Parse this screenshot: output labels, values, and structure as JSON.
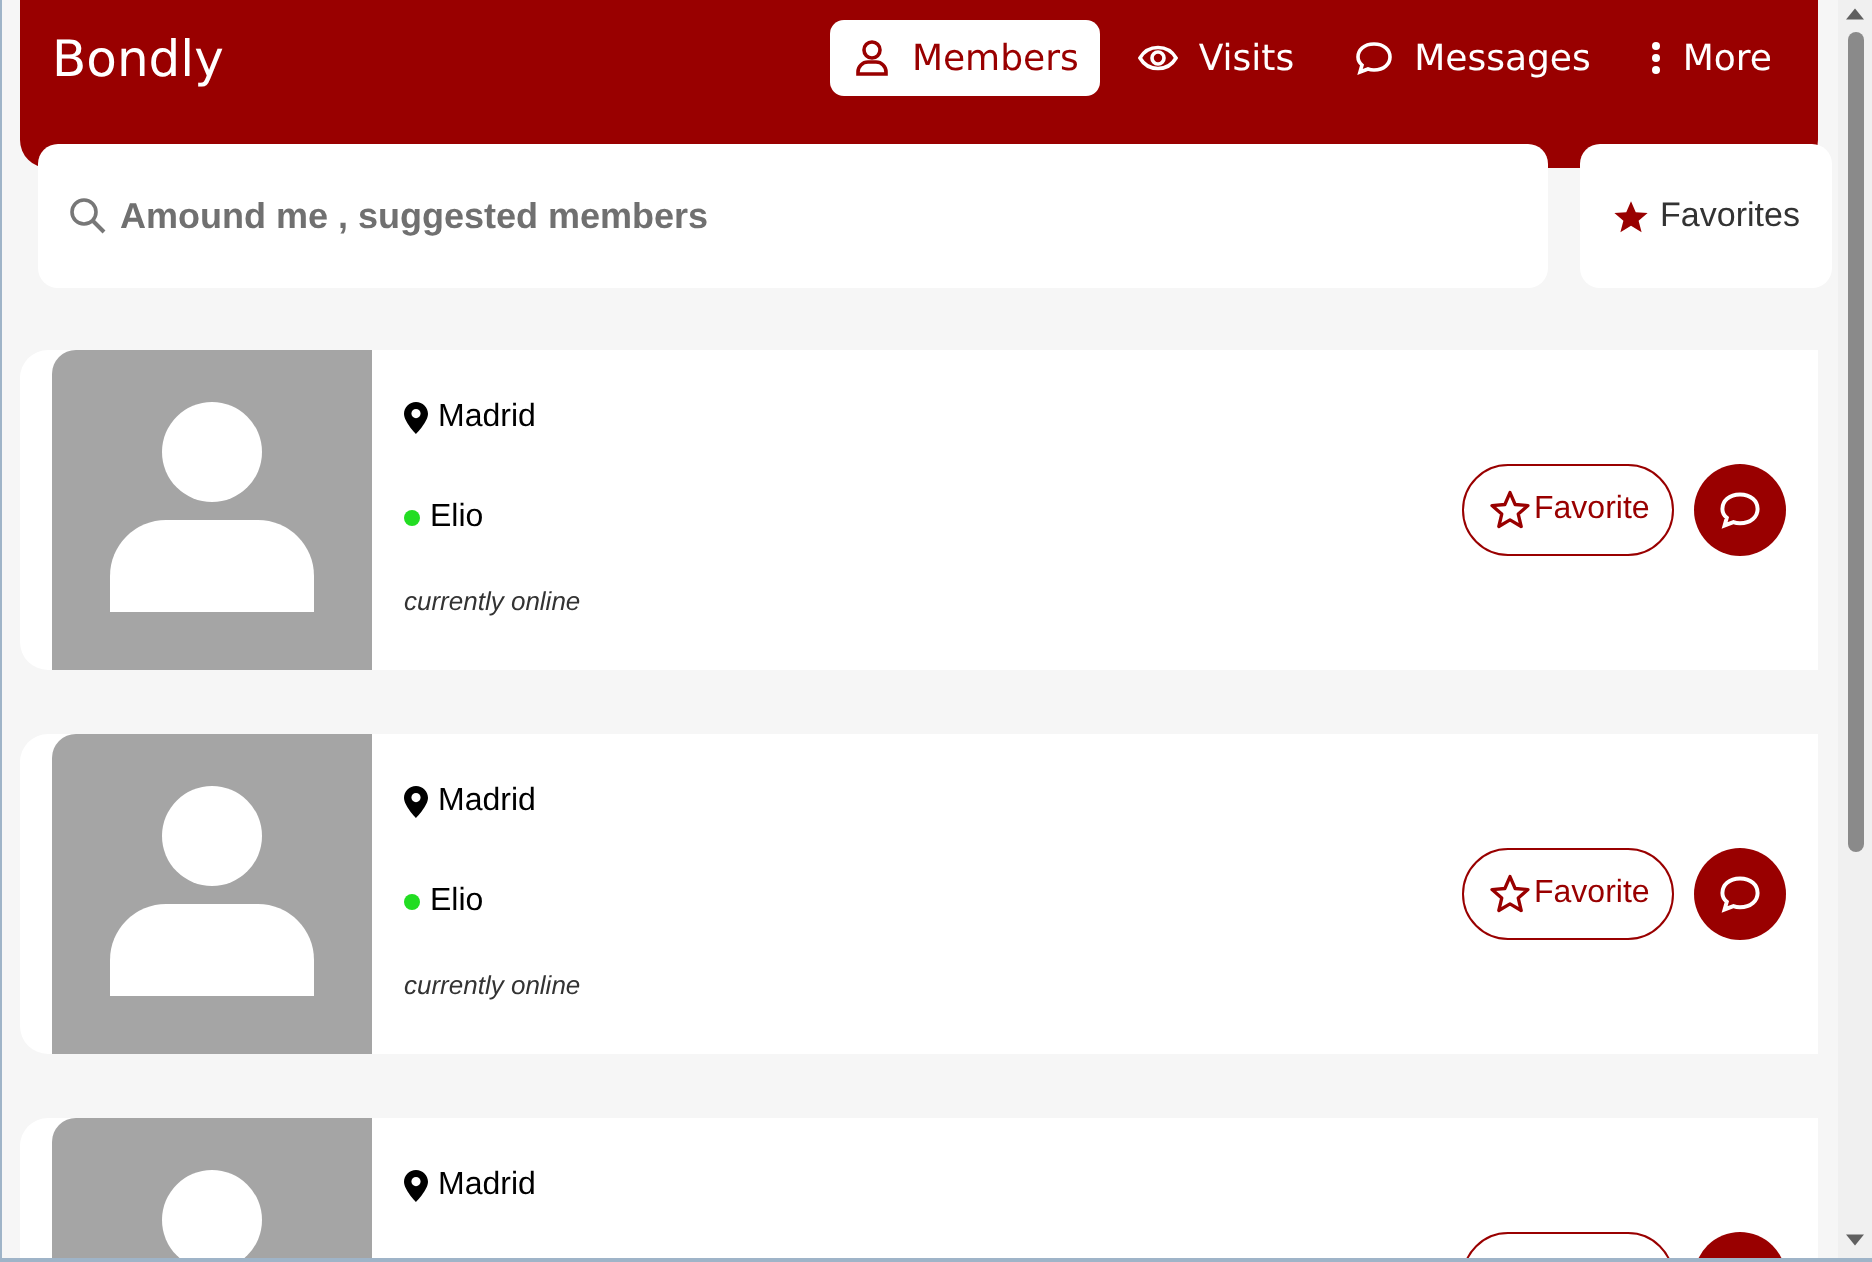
{
  "brand": "Bondly",
  "nav": [
    {
      "label": "Members",
      "kind": "person",
      "selected": true
    },
    {
      "label": "Visits",
      "kind": "eye",
      "selected": false
    },
    {
      "label": "Messages",
      "kind": "chat",
      "selected": false
    },
    {
      "label": "More",
      "kind": "dots",
      "selected": false
    }
  ],
  "search": {
    "placeholder": "Amound me , suggested members"
  },
  "favorites_button": "Favorites",
  "members": [
    {
      "location": "Madrid",
      "name": "Elio",
      "online": true,
      "status": "currently online",
      "favorite_label": "Favorite",
      "favorited": false
    },
    {
      "location": "Madrid",
      "name": "Elio",
      "online": true,
      "status": "currently online",
      "favorite_label": "Favorite",
      "favorited": false
    },
    {
      "location": "Madrid"
    }
  ]
}
